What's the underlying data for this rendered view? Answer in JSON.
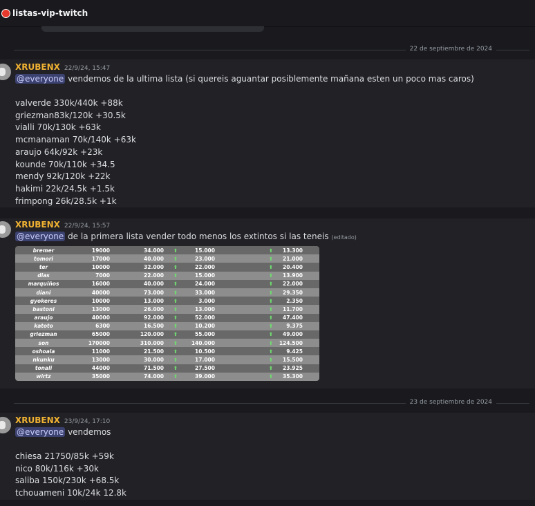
{
  "channel": {
    "name": "listas-vip-twitch"
  },
  "dividers": [
    "22 de septiembre de 2024",
    "23 de septiembre de 2024"
  ],
  "messages": [
    {
      "author": "XRUBENX",
      "timestamp": "22/9/24, 15:47",
      "mention": "@everyone",
      "text": "vendemos de la ultima lista (si quereis aguantar posiblemente mañana esten un poco mas caros)",
      "lines": [
        "valverde 330k/440k  +88k",
        "griezman83k/120k  +30.5k",
        "vialli 70k/130k  +63k",
        "mcmanaman 70k/140k +63k",
        "araujo 64k/92k  +23k",
        "kounde 70k/110k  +34.5",
        "mendy  92k/120k  +22k",
        "hakimi 22k/24.5k  +1.5k",
        "frimpong 26k/28.5k  +1k"
      ]
    },
    {
      "author": "XRUBENX",
      "timestamp": "22/9/24, 15:57",
      "mention": "@everyone",
      "text": "de la primera lista vender todo menos los extintos si las teneis",
      "edited": "(editado)",
      "table": {
        "arrow": "⬆",
        "rows": [
          [
            "bremer",
            "19000",
            "34.000",
            "15.000",
            "13.300"
          ],
          [
            "tomori",
            "17000",
            "40.000",
            "23.000",
            "21.000"
          ],
          [
            "ter",
            "10000",
            "32.000",
            "22.000",
            "20.400"
          ],
          [
            "dias",
            "7000",
            "22.000",
            "15.000",
            "13.900"
          ],
          [
            "marquiños",
            "16000",
            "40.000",
            "24.000",
            "22.000"
          ],
          [
            "diani",
            "40000",
            "73.000",
            "33.000",
            "29.350"
          ],
          [
            "gyokeres",
            "10000",
            "13.000",
            "3.000",
            "2.350"
          ],
          [
            "bastoni",
            "13000",
            "26.000",
            "13.000",
            "11.700"
          ],
          [
            "araujo",
            "40000",
            "92.000",
            "52.000",
            "47.400"
          ],
          [
            "katoto",
            "6300",
            "16.500",
            "10.200",
            "9.375"
          ],
          [
            "griezman",
            "65000",
            "120.000",
            "55.000",
            "49.000"
          ],
          [
            "son",
            "170000",
            "310.000",
            "140.000",
            "124.500"
          ],
          [
            "oshoala",
            "11000",
            "21.500",
            "10.500",
            "9.425"
          ],
          [
            "nkunku",
            "13000",
            "30.000",
            "17.000",
            "15.500"
          ],
          [
            "tonali",
            "44000",
            "71.500",
            "27.500",
            "23.925"
          ],
          [
            "wirtz",
            "35000",
            "74.000",
            "39.000",
            "35.300"
          ]
        ]
      }
    },
    {
      "author": "XRUBENX",
      "timestamp": "23/9/24, 17:10",
      "mention": "@everyone",
      "text": "vendemos",
      "lines": [
        "chiesa  21750/85k  +59k",
        "nico 80k/116k  +30k",
        "saliba 150k/230k  +68.5k",
        "tchouameni  10k/24k  12.8k"
      ]
    }
  ]
}
